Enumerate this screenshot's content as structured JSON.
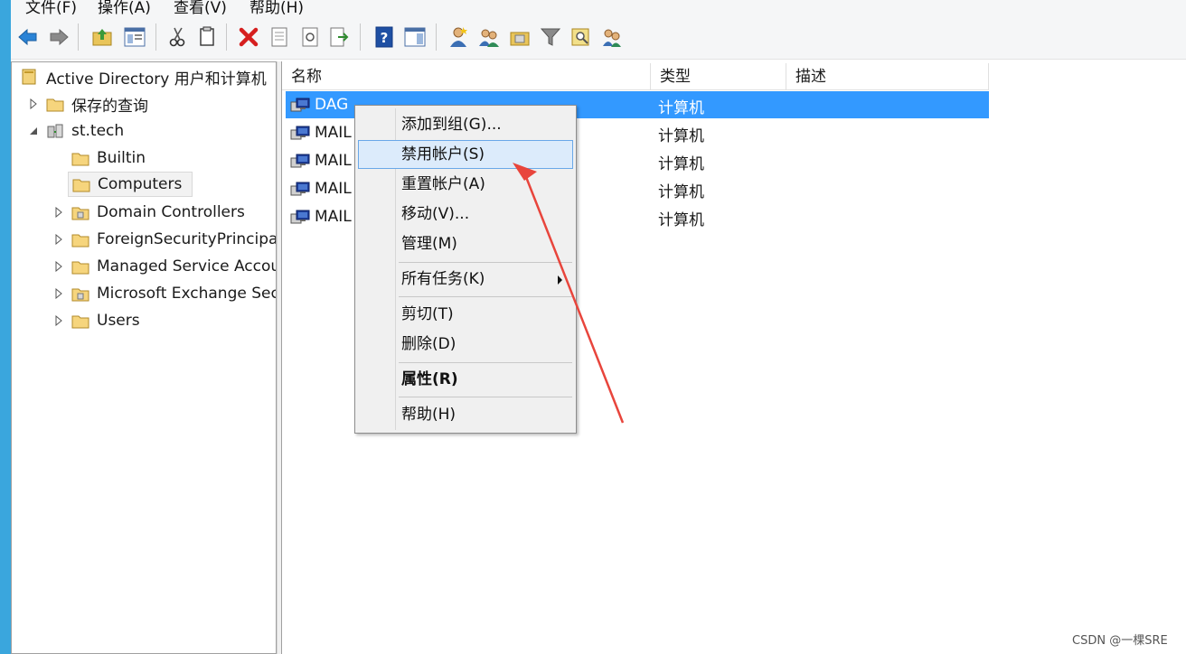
{
  "menu": {
    "file": "文件(F)",
    "action": "操作(A)",
    "view": "查看(V)",
    "help": "帮助(H)"
  },
  "toolbar": {
    "icons": [
      "back-arrow-icon",
      "forward-arrow-icon",
      "up-folder-icon",
      "show-console-tree-icon",
      "cut-icon",
      "copy-icon",
      "delete-icon",
      "properties-icon",
      "refresh-icon",
      "export-list-icon",
      "help-icon",
      "action-pane-icon",
      "new-user-icon",
      "new-group-icon",
      "new-ou-icon",
      "filter-icon",
      "find-icon",
      "add-to-group-icon"
    ]
  },
  "tree": {
    "root": "Active Directory 用户和计算机",
    "saved_queries": "保存的查询",
    "domain": "st.tech",
    "children": [
      {
        "label": "Builtin"
      },
      {
        "label": "Computers"
      },
      {
        "label": "Domain Controllers"
      },
      {
        "label": "ForeignSecurityPrincipals"
      },
      {
        "label": "Managed Service Accounts"
      },
      {
        "label": "Microsoft Exchange Security Groups"
      },
      {
        "label": "Users"
      }
    ]
  },
  "list": {
    "columns": [
      "名称",
      "类型",
      "描述"
    ],
    "rows": [
      {
        "name": "DAG",
        "type": "计算机",
        "selected": true
      },
      {
        "name": "MAIL",
        "type": "计算机"
      },
      {
        "name": "MAIL",
        "type": "计算机"
      },
      {
        "name": "MAIL",
        "type": "计算机"
      },
      {
        "name": "MAIL",
        "type": "计算机"
      }
    ]
  },
  "context_menu": {
    "items": [
      {
        "label": "添加到组(G)..."
      },
      {
        "label": "禁用帐户(S)",
        "highlighted": true
      },
      {
        "label": "重置帐户(A)"
      },
      {
        "label": "移动(V)..."
      },
      {
        "label": "管理(M)"
      },
      {
        "label": "所有任务(K)",
        "submenu": true
      },
      {
        "label": "剪切(T)"
      },
      {
        "label": "删除(D)"
      },
      {
        "label": "属性(R)",
        "bold": true
      },
      {
        "label": "帮助(H)"
      }
    ]
  },
  "watermark": "CSDN @一棵SRE",
  "colors": {
    "selection": "#3399ff",
    "menu_hover": "#dcebfb",
    "annotation_arrow": "#e8453c",
    "window_accent": "#3aa6dd"
  }
}
